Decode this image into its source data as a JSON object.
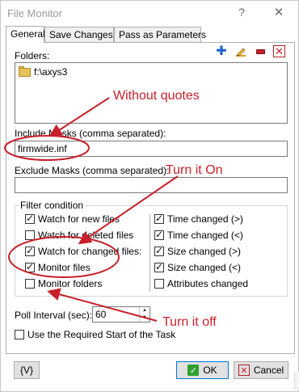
{
  "window": {
    "title": "File Monitor",
    "help_glyph": "?",
    "close_glyph": "✕"
  },
  "tabs": [
    {
      "label": "General",
      "active": true
    },
    {
      "label": "Save Changes",
      "active": false
    },
    {
      "label": "Pass as Parameters",
      "active": false
    }
  ],
  "folders": {
    "label": "Folders:",
    "toolbar": {
      "add": "✚",
      "edit": "✎",
      "remove": "",
      "delete": "✕"
    },
    "items": [
      "f:\\axys3"
    ]
  },
  "include_masks": {
    "label": "Include Masks (comma separated):",
    "value": "firmwide.inf"
  },
  "exclude_masks": {
    "label": "Exclude Masks (comma separated):",
    "value": ""
  },
  "filter": {
    "title": "Filter condition",
    "left": [
      {
        "label": "Watch for new files",
        "checked": true
      },
      {
        "label": "Watch for deleted files",
        "checked": false
      },
      {
        "label": "Watch for changed files:",
        "checked": true
      },
      {
        "label": "Monitor files",
        "checked": true
      },
      {
        "label": "Monitor folders",
        "checked": false
      }
    ],
    "right": [
      {
        "label": "Time changed (>)",
        "checked": true
      },
      {
        "label": "Time changed (<)",
        "checked": true
      },
      {
        "label": "Size changed (>)",
        "checked": true
      },
      {
        "label": "Size changed (<)",
        "checked": true
      },
      {
        "label": "Attributes changed",
        "checked": false
      }
    ]
  },
  "poll": {
    "label": "Poll Interval (sec):",
    "value": "60",
    "up": "▲",
    "down": "▼"
  },
  "required_start": {
    "label": "Use the Required Start of the Task",
    "checked": false
  },
  "buttons": {
    "variables": "{V}",
    "ok": "OK",
    "ok_icon": "✓",
    "cancel": "Cancel",
    "cancel_icon": "✕"
  },
  "annotations": {
    "without_quotes": "Without quotes",
    "turn_on": "Turn it On",
    "turn_off": "Turn it off",
    "color": "#c8202a"
  }
}
